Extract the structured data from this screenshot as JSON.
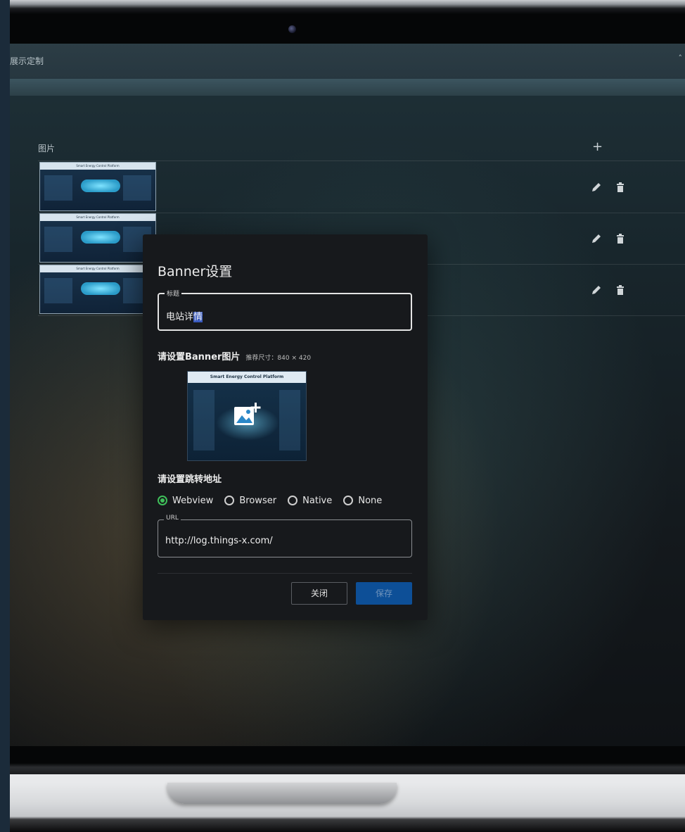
{
  "app": {
    "topbar_title": "展示定制",
    "collapse_icon": "chevron-up-icon",
    "section_label": "图片",
    "add_icon": "plus-icon",
    "banner_thumb_title": "Smart Energy Control Platform",
    "rows": [
      {
        "edit_icon": "pencil-icon",
        "delete_icon": "trash-icon"
      },
      {
        "edit_icon": "pencil-icon",
        "delete_icon": "trash-icon"
      },
      {
        "edit_icon": "pencil-icon",
        "delete_icon": "trash-icon"
      }
    ]
  },
  "dialog": {
    "title": "Banner设置",
    "title_field": {
      "legend": "标题",
      "value": "电站详情",
      "selected": "情"
    },
    "image_section": {
      "label": "请设置Banner图片",
      "hint": "推荐尺寸：840 × 420",
      "preview_title": "Smart Energy Control Platform",
      "upload_icon": "add-image-icon"
    },
    "link_section": {
      "label": "请设置跳转地址",
      "options": [
        "Webview",
        "Browser",
        "Native",
        "None"
      ],
      "selected": "Webview"
    },
    "url_field": {
      "legend": "URL",
      "value": "http://log.things-x.com/"
    },
    "buttons": {
      "close": "关闭",
      "save": "保存"
    }
  },
  "colors": {
    "radio_selected": "#3fbf5a",
    "save_button": "#0d4f97",
    "dialog_bg": "#17191c"
  }
}
